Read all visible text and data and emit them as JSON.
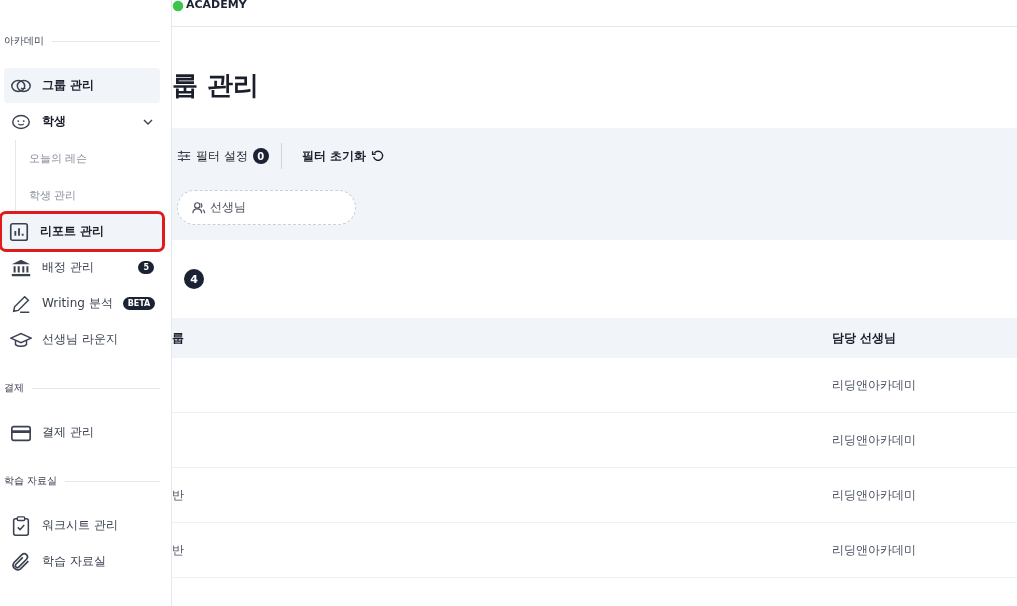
{
  "sidebar": {
    "sections": [
      {
        "label": "아카데미",
        "items": [
          {
            "kind": "item",
            "label": "그룹 관리",
            "selected": true,
            "highlighted": false
          },
          {
            "kind": "parent",
            "label": "학생",
            "selected": false,
            "highlighted": false,
            "expanded": true,
            "children": [
              {
                "label": "오늘의 레슨",
                "selected": false
              },
              {
                "label": "학생 관리",
                "selected": false
              }
            ]
          },
          {
            "kind": "item",
            "label": "리포트 관리",
            "selected": true,
            "highlighted": true
          },
          {
            "kind": "item",
            "label": "배정 관리",
            "selected": false,
            "highlighted": false,
            "badge": "5"
          },
          {
            "kind": "item",
            "label": "Writing 분석",
            "selected": false,
            "highlighted": false,
            "badge": "BETA"
          },
          {
            "kind": "item",
            "label": "선생님 라운지",
            "selected": false,
            "highlighted": false
          }
        ]
      },
      {
        "label": "결제",
        "items": [
          {
            "kind": "item",
            "label": "결제 관리",
            "selected": false,
            "highlighted": false
          }
        ]
      },
      {
        "label": "학습 자료실",
        "items": [
          {
            "kind": "item",
            "label": "워크시트 관리",
            "selected": false,
            "highlighted": false
          },
          {
            "kind": "item",
            "label": "학습 자료실",
            "selected": false,
            "highlighted": false
          }
        ]
      }
    ]
  },
  "header": {
    "logo": "ACADEMY"
  },
  "page_title": "룹 관리",
  "filters": {
    "settings_label": "필터 설정",
    "settings_count": "0",
    "reset_label": "필터 초기화",
    "chip": "선생님"
  },
  "count": "4",
  "table": {
    "columns": [
      "룹",
      "담당 선생님"
    ],
    "rows": [
      {
        "column_1": "",
        "teacher": "리딩앤아카데미"
      },
      {
        "column_1": "",
        "teacher": "리딩앤아카데미"
      },
      {
        "column_1": "반",
        "teacher": "리딩앤아카데미"
      },
      {
        "column_1": "반",
        "teacher": "리딩앤아카데미"
      }
    ]
  }
}
